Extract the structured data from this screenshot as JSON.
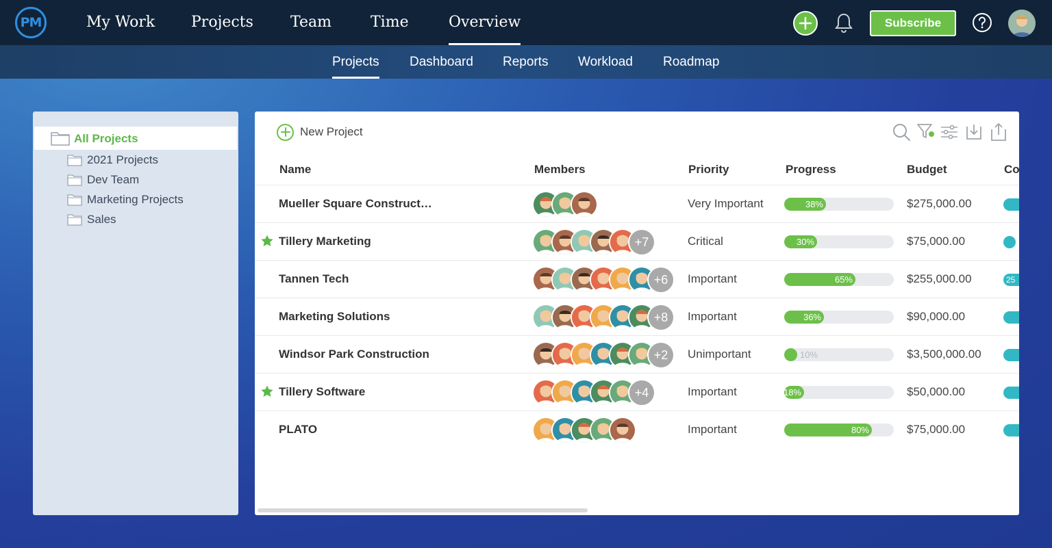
{
  "app": {
    "logo": "PM"
  },
  "main_nav": [
    {
      "label": "My Work",
      "active": false
    },
    {
      "label": "Projects",
      "active": false
    },
    {
      "label": "Team",
      "active": false
    },
    {
      "label": "Time",
      "active": false
    },
    {
      "label": "Overview",
      "active": true
    }
  ],
  "header": {
    "subscribe_label": "Subscribe"
  },
  "sub_nav": [
    {
      "label": "Projects",
      "active": true
    },
    {
      "label": "Dashboard",
      "active": false
    },
    {
      "label": "Reports",
      "active": false
    },
    {
      "label": "Workload",
      "active": false
    },
    {
      "label": "Roadmap",
      "active": false
    }
  ],
  "sidebar": {
    "all_label": "All Projects",
    "folders": [
      "2021 Projects",
      "Dev Team",
      "Marketing Projects",
      "Sales"
    ]
  },
  "toolbar": {
    "new_project_label": "New Project"
  },
  "table": {
    "columns": [
      "Name",
      "Members",
      "Priority",
      "Progress",
      "Budget",
      "Co"
    ],
    "rows": [
      {
        "starred": false,
        "name": "Mueller Square Construct…",
        "members_shown": 3,
        "more": "",
        "priority": "Very Important",
        "progress": 38,
        "progress_label": "38%",
        "budget": "$275,000.00",
        "tag": ""
      },
      {
        "starred": true,
        "name": "Tillery Marketing",
        "members_shown": 5,
        "more": "+7",
        "priority": "Critical",
        "progress": 30,
        "progress_label": "30%",
        "budget": "$75,000.00",
        "tag": ""
      },
      {
        "starred": false,
        "name": "Tannen Tech",
        "members_shown": 6,
        "more": "+6",
        "priority": "Important",
        "progress": 65,
        "progress_label": "65%",
        "budget": "$255,000.00",
        "tag": "25"
      },
      {
        "starred": false,
        "name": "Marketing Solutions",
        "members_shown": 6,
        "more": "+8",
        "priority": "Important",
        "progress": 36,
        "progress_label": "36%",
        "budget": "$90,000.00",
        "tag": ""
      },
      {
        "starred": false,
        "name": "Windsor Park Construction",
        "members_shown": 6,
        "more": "+2",
        "priority": "Unimportant",
        "progress": 10,
        "progress_label": "10%",
        "budget": "$3,500,000.00",
        "tag": ""
      },
      {
        "starred": true,
        "name": "Tillery Software",
        "members_shown": 5,
        "more": "+4",
        "priority": "Important",
        "progress": 18,
        "progress_label": "18%",
        "budget": "$50,000.00",
        "tag": ""
      },
      {
        "starred": false,
        "name": "PLATO",
        "members_shown": 5,
        "more": "",
        "priority": "Important",
        "progress": 80,
        "progress_label": "80%",
        "budget": "$75,000.00",
        "tag": ""
      }
    ]
  },
  "colors": {
    "accent_green": "#6cc04a",
    "nav_bg": "#112338",
    "teal": "#32b8c4"
  },
  "icons": [
    "add-icon",
    "bell-icon",
    "help-icon",
    "search-icon",
    "filter-icon",
    "settings-sliders-icon",
    "download-icon",
    "share-icon",
    "folder-icon",
    "star-icon"
  ]
}
